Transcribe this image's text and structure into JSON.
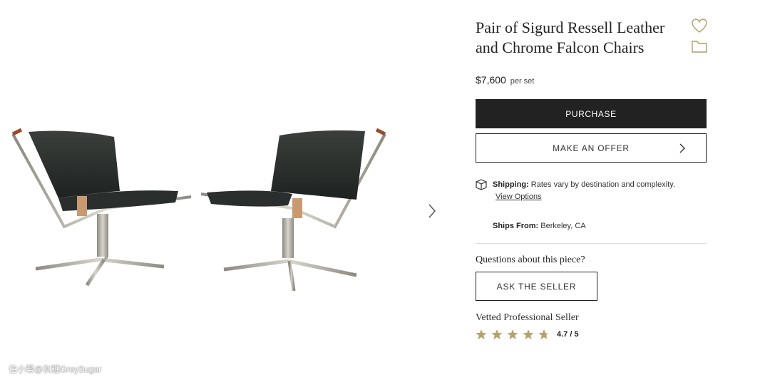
{
  "listing": {
    "title": "Pair of Sigurd Ressell Leather and Chrome Falcon Chairs",
    "price": "$7,600",
    "price_unit": "per set"
  },
  "actions": {
    "purchase_label": "PURCHASE",
    "offer_label": "MAKE AN OFFER",
    "ask_label": "ASK THE SELLER"
  },
  "shipping": {
    "label": "Shipping:",
    "text": "Rates vary by destination and complexity.",
    "link": "View Options",
    "from_label": "Ships From:",
    "from_value": "Berkeley, CA"
  },
  "seller": {
    "questions": "Questions about this piece?",
    "badge": "Vetted Professional Seller",
    "rating": 4.7,
    "rating_text": "4.7 / 5"
  },
  "watermark": "住小帮@灰糖GreySugar",
  "icons": {
    "favorite": "heart-outline-icon",
    "save": "folder-outline-icon",
    "next": "chevron-right-icon",
    "shipping": "package-icon",
    "rating": "star-icon"
  },
  "colors": {
    "accent_gold": "#b59a64",
    "button_dark": "#222222",
    "star": "#b8a06c"
  }
}
